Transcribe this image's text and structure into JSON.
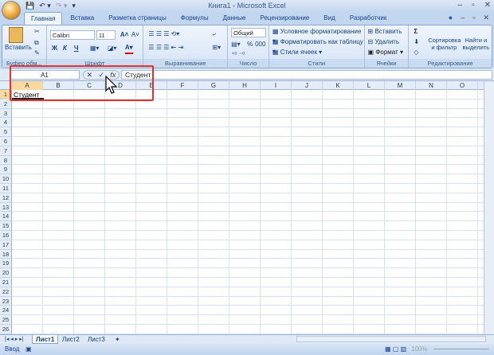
{
  "window": {
    "title": "Книга1 - Microsoft Excel"
  },
  "tabs": [
    "Главная",
    "Вставка",
    "Разметка страницы",
    "Формулы",
    "Данные",
    "Рецензирование",
    "Вид",
    "Разработчик"
  ],
  "ribbon": {
    "clipboard": {
      "paste": "Вставить",
      "label": "Буфер обм..."
    },
    "font": {
      "name": "Calibri",
      "size": "11",
      "bold": "Ж",
      "italic": "К",
      "underline": "Ч",
      "label": "Шрифт"
    },
    "alignment": {
      "label": "Выравнивание"
    },
    "number": {
      "format": "Общий",
      "percent": "%",
      "thousands": "000",
      "label": "Число"
    },
    "styles": {
      "conditional": "Условное форматирование",
      "as_table": "Форматировать как таблицу",
      "cell_styles": "Стили ячеек",
      "label": "Стили"
    },
    "cells": {
      "insert": "Вставить",
      "delete": "Удалить",
      "format": "Формат",
      "label": "Ячейки"
    },
    "editing": {
      "sum": "Σ",
      "sort": "Сортировка и фильтр",
      "find": "Найти и выделить",
      "label": "Редактирование"
    }
  },
  "formula_bar": {
    "name_box": "A1",
    "cancel": "✕",
    "enter": "✓",
    "fx": "fx",
    "value": "Студент"
  },
  "columns": [
    "A",
    "B",
    "C",
    "D",
    "E",
    "F",
    "G",
    "H",
    "I",
    "J",
    "K",
    "L",
    "M",
    "N",
    "O"
  ],
  "rows": [
    "1",
    "2",
    "3",
    "4",
    "5",
    "6",
    "7",
    "8",
    "9",
    "10",
    "11",
    "12",
    "13",
    "14",
    "15",
    "16",
    "17",
    "18",
    "19",
    "20",
    "21",
    "22",
    "23",
    "24",
    "25",
    "26"
  ],
  "cell_a1": "Студент",
  "sheets": [
    "Лист1",
    "Лист2",
    "Лист3"
  ],
  "status": {
    "mode": "Ввод",
    "zoom": "100%"
  },
  "colors": {
    "highlight": "#e8312a",
    "selected_header": "#f9d99f"
  }
}
